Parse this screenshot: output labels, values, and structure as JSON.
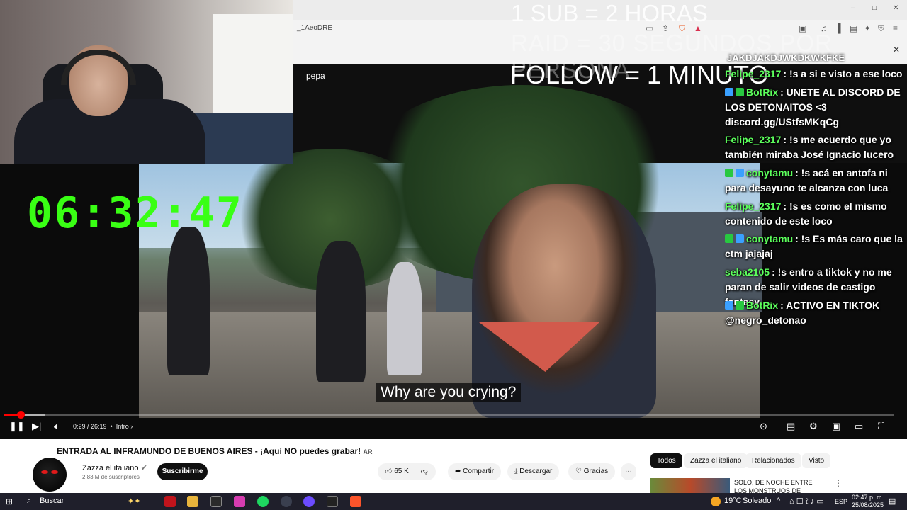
{
  "browser": {
    "url_fragment": "_1AeoDRE",
    "ytsearch_value": "pepa"
  },
  "overlay": {
    "line1": "1 SUB = 2 HORAS",
    "line2": "RAID = 30 SEGUNDOS POR PERSONA",
    "line3": "FOLLOW = 1 MINUTO"
  },
  "stream": {
    "timer": "06:32:47",
    "subtitle": "Why are you crying?"
  },
  "player": {
    "time": "0:29 / 26:19",
    "chapter": "Intro",
    "progress_fraction": 0.018
  },
  "chat": {
    "cut_top": "JAKDJAKDJWKDKWKFKE",
    "messages": [
      {
        "user": "Felipe_2317",
        "user_color": "#5cff5c",
        "text": ": !s a si e visto a ese loco",
        "badges": []
      },
      {
        "user": "BotRix",
        "user_color": "#5cff5c",
        "text": ": UNETE AL DISCORD DE LOS DETONAITOS <3 discord.gg/UStfsMKqCg",
        "badges": [
          "#3aa0ff",
          "#28c840"
        ]
      },
      {
        "user": "Felipe_2317",
        "user_color": "#5cff5c",
        "text": ": !s me acuerdo que yo también miraba José Ignacio lucero",
        "badges": []
      },
      {
        "user": "conytamu",
        "user_color": "#5cff5c",
        "text": ": !s acá en antofa ni para desayuno te alcanza con luca",
        "badges": [
          "#28c840",
          "#3aa0ff"
        ]
      },
      {
        "user": "Felipe_2317",
        "user_color": "#5cff5c",
        "text": ": !s es como el mismo contenido de este loco",
        "badges": []
      },
      {
        "user": "conytamu",
        "user_color": "#5cff5c",
        "text": ": !s Es más caro que la ctm jajajaj",
        "badges": [
          "#28c840",
          "#3aa0ff"
        ]
      },
      {
        "user": "seba2105",
        "user_color": "#5cff5c",
        "text": ": !s entro a tiktok y no me paran de salir videos de castigo fantasy",
        "badges": []
      },
      {
        "user": "BotRix",
        "user_color": "#5cff5c",
        "text": ": ACTIVO EN TIKTOK @negro_detonao",
        "badges": [
          "#3aa0ff",
          "#28c840"
        ]
      }
    ]
  },
  "video": {
    "title": "ENTRADA AL INFRAMUNDO DE BUENOS AIRES - ¡Aquí NO puedes grabar!",
    "title_suffix": "AR",
    "channel": "Zazza el italiano",
    "subscribers": "2,83 M de suscriptores",
    "subscribe": "Suscribirme",
    "likes": "65 K",
    "share": "Compartir",
    "download": "Descargar",
    "thanks": "Gracias",
    "more": "···"
  },
  "related": {
    "tabs": [
      "Todos",
      "Zazza el italiano",
      "Relacionados",
      "Visto"
    ],
    "first_title": "SOLO, DE NOCHE ENTRE LOS MONSTRUOS DE SANTIAGO..."
  },
  "taskbar": {
    "search": "Buscar",
    "weather_temp": "19°C",
    "weather_text": "Soleado",
    "lang": "ESP",
    "time": "02:47 p. m.",
    "date": "25/08/2025"
  }
}
